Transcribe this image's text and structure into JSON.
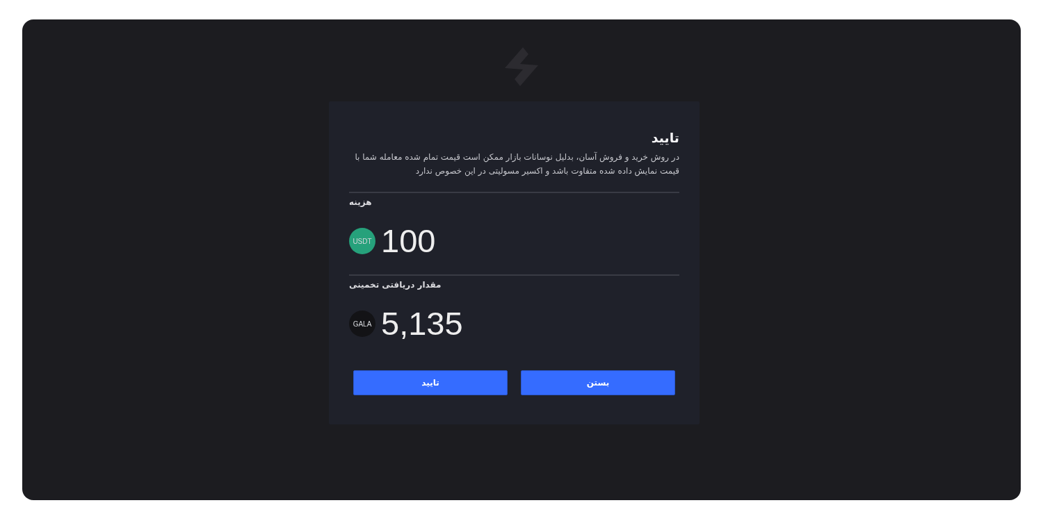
{
  "dialog": {
    "title": "تایید",
    "message": "در روش خرید و فروش آسان، بدلیل نوسانات بازار ممکن است قیمت تمام شده معامله شما با قیمت نمایش داده شده متفاوت باشد و اکسیر مسولیتی در این خصوص ندارد",
    "sections": [
      {
        "label": "هزینه",
        "token": {
          "symbol": "USDT",
          "color": "#26a17b"
        },
        "amount": "100"
      },
      {
        "label": "مقدار دریافتی تخمینی",
        "token": {
          "symbol": "GALA",
          "color": "#131316"
        },
        "amount": "5,135"
      }
    ],
    "buttons": [
      "بستن",
      "تایید"
    ]
  }
}
